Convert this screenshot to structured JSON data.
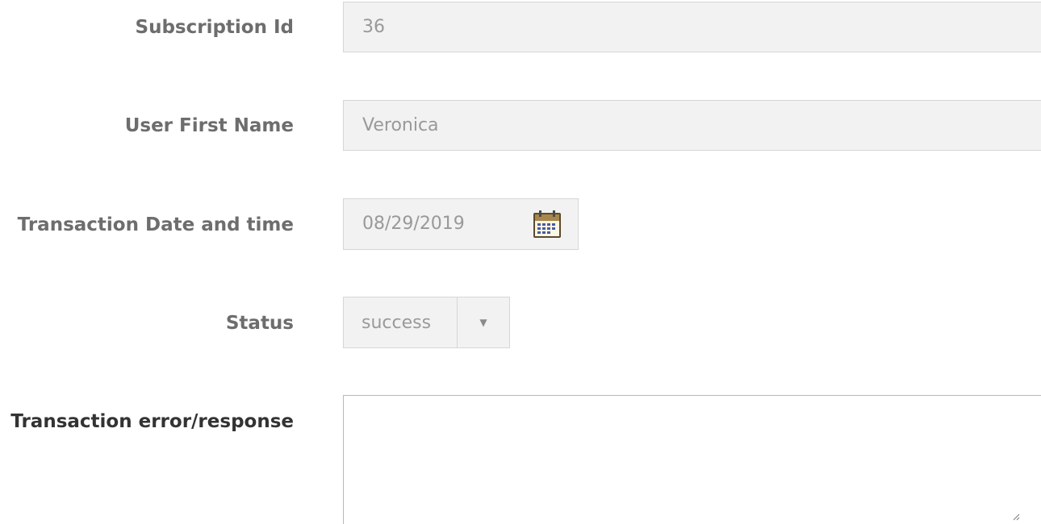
{
  "form": {
    "subscription_id": {
      "label": "Subscription Id",
      "value": "36"
    },
    "user_first_name": {
      "label": "User First Name",
      "value": "Veronica"
    },
    "transaction_date": {
      "label": "Transaction Date and time",
      "value": "08/29/2019",
      "icon": "calendar-icon"
    },
    "status": {
      "label": "Status",
      "selected": "success",
      "icon": "dropdown-arrow-icon"
    },
    "transaction_response": {
      "label": "Transaction error/response",
      "value": ""
    }
  },
  "colors": {
    "label_muted": "#6d6d6d",
    "label_active": "#333333",
    "field_bg": "#f2f2f2",
    "field_border": "#d6d6d6",
    "field_text": "#999999"
  }
}
